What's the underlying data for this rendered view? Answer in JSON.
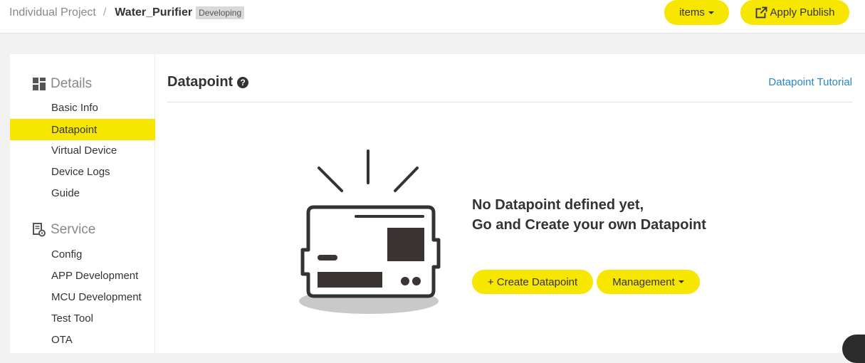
{
  "header": {
    "breadcrumb_root": "Individual Project",
    "breadcrumb_sep": "/",
    "project_name": "Water_Purifier",
    "status": "Developing",
    "items_label": "items",
    "publish_label": "Apply Publish"
  },
  "sidebar": {
    "sections": [
      {
        "title": "Details",
        "icon": "grid-icon",
        "items": [
          {
            "label": "Basic Info",
            "active": false
          },
          {
            "label": "Datapoint",
            "active": true
          },
          {
            "label": "Virtual Device",
            "active": false
          },
          {
            "label": "Device Logs",
            "active": false
          },
          {
            "label": "Guide",
            "active": false
          }
        ]
      },
      {
        "title": "Service",
        "icon": "service-gear-icon",
        "items": [
          {
            "label": "Config",
            "active": false
          },
          {
            "label": "APP Development",
            "active": false
          },
          {
            "label": "MCU Development",
            "active": false
          },
          {
            "label": "Test Tool",
            "active": false
          },
          {
            "label": "OTA",
            "active": false
          }
        ]
      }
    ]
  },
  "main": {
    "title": "Datapoint",
    "help_icon": "question-circle-icon",
    "tutorial_link": "Datapoint Tutorial",
    "empty_line1": "No Datapoint defined yet,",
    "empty_line2": "Go and Create your own Datapoint",
    "create_label": "+ Create Datapoint",
    "management_label": "Management"
  },
  "colors": {
    "accent": "#f7e600",
    "link": "#2a87c9",
    "text": "#333333"
  }
}
